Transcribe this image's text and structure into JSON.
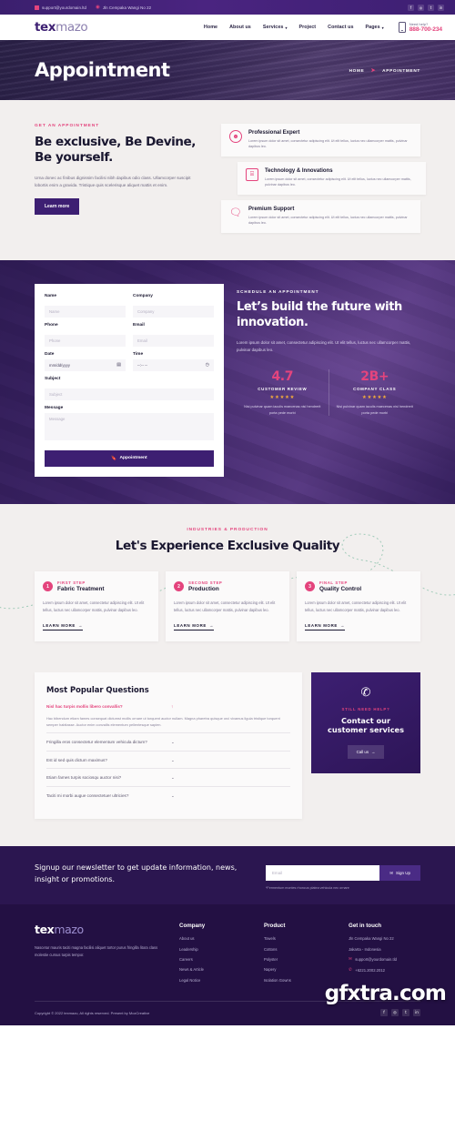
{
  "topbar": {
    "email": "support@yourdomain.ltd",
    "address": "Jln Cempaka Wangi No 22",
    "socials": [
      "f",
      "◎",
      "t",
      "in"
    ]
  },
  "nav": {
    "logo_part1": "tex",
    "logo_part2": "mazo",
    "links": [
      {
        "label": "Home",
        "caret": ""
      },
      {
        "label": "About us",
        "caret": ""
      },
      {
        "label": "Services",
        "caret": "▾"
      },
      {
        "label": "Project",
        "caret": ""
      },
      {
        "label": "Contact us",
        "caret": ""
      },
      {
        "label": "Pages",
        "caret": "▾"
      }
    ],
    "help_label": "Need help?",
    "phone": "888-700-234"
  },
  "hero": {
    "title": "Appointment",
    "crumb_home": "HOME",
    "crumb_sep": "➤",
    "crumb_current": "APPOINTMENT"
  },
  "appointment_section": {
    "eyebrow": "GET AN APPOINTMENT",
    "heading": "Be exclusive, Be Devine, Be yourself.",
    "paragraph": "Urna donec ac finibus dignissim facilisi nibh dapibus odio class. Ullamcorper suscipit lobortis enim a gravida. Tristique quis scelerisque aliquet mattis et enim.",
    "button": "Learn more",
    "features": [
      {
        "icon": "user-circle-icon",
        "title": "Professional Expert",
        "text": "Lorem ipsum dolor sit amet, consectetur adipiscing elit. Ut elit tellus, luctus nec ullamcorper mattis, pulvinar dapibus leo."
      },
      {
        "icon": "machine-icon",
        "title": "Technology & Innovations",
        "text": "Lorem ipsum dolor sit amet, consectetur adipiscing elit. Ut elit tellus, luctus nec ullamcorper mattis, pulvinar dapibus leo."
      },
      {
        "icon": "chat-support-icon",
        "title": "Premium Support",
        "text": "Lorem ipsum dolor sit amet, consectetur adipiscing elit. Ut elit tellus, luctus nec ullamcorper mattis, pulvinar dapibus leo."
      }
    ]
  },
  "form": {
    "name_label": "Name",
    "name_placeholder": "Name",
    "company_label": "Company",
    "company_placeholder": "Company",
    "phone_label": "Phone",
    "phone_placeholder": "Phone",
    "email_label": "Email",
    "email_placeholder": "Email",
    "date_label": "Date",
    "date_value": "mm/dd/yyyy",
    "time_label": "Time",
    "time_value": "--:-- --",
    "subject_label": "Subject",
    "subject_placeholder": "Subject",
    "message_label": "Message",
    "message_placeholder": "Message",
    "submit_label": "Appointment",
    "submit_icon": "🔖"
  },
  "schedule": {
    "eyebrow": "SCHEDULE AN APPOINTMENT",
    "heading": "Let’s build the future with innovation.",
    "paragraph": "Lorem ipsum dolor sit amet, consectetur adipiscing elit. Ut elit tellus, luctus nec ullamcorper mattis, pulvinar dapibus leo.",
    "stats": [
      {
        "number": "4.7",
        "caption": "CUSTOMER REVIEW",
        "stars": "★★★★★",
        "text": "Nisi pulvinar quam iaculis maecenas nisl hendrerit porta pede morbi"
      },
      {
        "number": "2B+",
        "caption": "COMPANY CLASS",
        "stars": "★★★★★",
        "text": "Nisi pulvinar quam iaculis maecenas nisl hendrerit porta pede morbi"
      }
    ]
  },
  "quality": {
    "eyebrow": "INDUSTRIES & PRODUCTION",
    "heading": "Let's Experience Exclusive Quality",
    "steps": [
      {
        "badge": "1",
        "label": "FIRST STEP",
        "title": "Fabric Treatment",
        "text": "Lorem ipsum dolor sit amet, consectetur adipiscing elit. Ut elit tellus, luctus nec ullamcorper mattis, pulvinar dapibus leo.",
        "link": "LEARN MORE"
      },
      {
        "badge": "2",
        "label": "SECOND STEP",
        "title": "Production",
        "text": "Lorem ipsum dolor sit amet, consectetur adipiscing elit. Ut elit tellus, luctus nec ullamcorper mattis, pulvinar dapibus leo.",
        "link": "LEARN MORE"
      },
      {
        "badge": "3",
        "label": "FINAL STEP",
        "title": "Quality Control",
        "text": "Lorem ipsum dolor sit amet, consectetur adipiscing elit. Ut elit tellus, luctus nec ullamcorper mattis, pulvinar dapibus leo.",
        "link": "LEARN MORE"
      }
    ]
  },
  "faq": {
    "title": "Most Popular Questions",
    "items": [
      {
        "question": "Nisl hac turpis mollis libero convallis?",
        "answer": "Hac bibendum etiam fames consequat dictumst mollis ornare ut torquent auctor nullam. Magna pharetra quisque orci vivamus ligula tristique torquent semper habitasse. Auctor enim convallis elementum pellentesque sapien.",
        "open": true,
        "chevron": "↑"
      },
      {
        "question": "Fringilla eros consectetur elementum vehicula dictum?",
        "answer": "",
        "open": false,
        "chevron": "⌄"
      },
      {
        "question": "Est id sed quis dictum maximus?",
        "answer": "",
        "open": false,
        "chevron": "⌄"
      },
      {
        "question": "Etiam fames turpis sociosqu auctor nisi?",
        "answer": "",
        "open": false,
        "chevron": "⌄"
      },
      {
        "question": "Taciti mi morbi augue consectetuer ultricies?",
        "answer": "",
        "open": false,
        "chevron": "⌄"
      }
    ],
    "help": {
      "icon": "phone-ring-icon",
      "eyebrow": "STILL NEED HELP?",
      "heading": "Contact our customer services",
      "button": "Call us",
      "button_arrow": "→"
    }
  },
  "newsletter": {
    "text": "Signup our newsletter to get update information, news, insight or promotions.",
    "email_placeholder": "Email",
    "button": "Sign Up",
    "button_icon": "✉",
    "note": "*Fermentum montes rhoncus platea vehicula nec ornare"
  },
  "footer": {
    "logo_part1": "tex",
    "logo_part2": "mazo",
    "tagline": "Nascetur mauris taciti magna facilisi aliquet tortor purus fringilla litora class molestie cursus turpis tempor.",
    "columns": [
      {
        "title": "Company",
        "links": [
          "About us",
          "Leadership",
          "Careers",
          "News & Article",
          "Legal Notice"
        ]
      },
      {
        "title": "Product",
        "links": [
          "Towels",
          "Cottons",
          "Polyster",
          "Napery",
          "Isolation Gowns"
        ]
      }
    ],
    "contact_title": "Get in touch",
    "contact": [
      {
        "icon": "",
        "text": "Jln Cempaka Wangi No 22"
      },
      {
        "icon": "",
        "text": "Jakarta - Indonesia"
      },
      {
        "icon": "✉",
        "text": "support@yourdomain.tld"
      },
      {
        "icon": "✆",
        "text": "+6221.2002.2012"
      }
    ],
    "copyright": "Copyright © 2022 texmazo, All rights reserved. Present by MozCreative",
    "socials": [
      "f",
      "◎",
      "t",
      "in"
    ]
  },
  "watermark": "gfxtra.com",
  "colors": {
    "accent_pink": "#e4447d",
    "purple_dark": "#3d1f72",
    "footer_bg": "#231043",
    "section_bg": "#f2efee"
  }
}
